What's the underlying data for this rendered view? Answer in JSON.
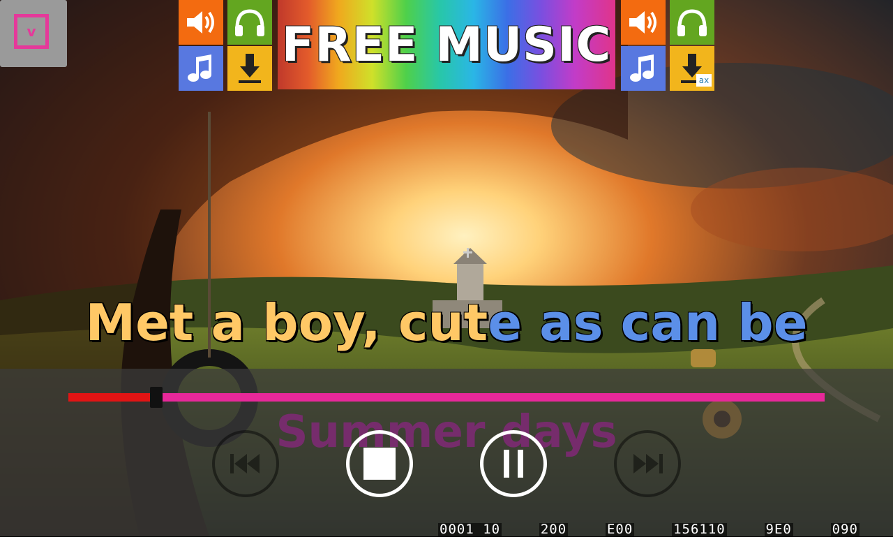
{
  "app": {
    "collapse_button": {
      "glyph": "v",
      "icon": "chevron-down-icon"
    }
  },
  "ad": {
    "title": "FREE MUSIC",
    "badge": "ax",
    "tiles": [
      {
        "icon": "speaker-icon",
        "color": "#f36b10"
      },
      {
        "icon": "headphones-icon",
        "color": "#63a620"
      },
      {
        "icon": "music-note-icon",
        "color": "#5878e0"
      },
      {
        "icon": "download-icon",
        "color": "#f2b51c"
      }
    ]
  },
  "lyrics": {
    "current_sung": "Met a boy, cut",
    "current_unsung": "e as can be",
    "next": "Summer days",
    "sung_color": "#ffc866",
    "unsung_color": "#5b8fe8"
  },
  "player": {
    "progress_fraction": 0.108,
    "played_color": "#e21414",
    "remaining_color": "#e8289a",
    "buttons": [
      {
        "name": "previous-button",
        "icon": "skip-previous-icon",
        "enabled": false
      },
      {
        "name": "stop-button",
        "icon": "stop-icon",
        "enabled": true
      },
      {
        "name": "pause-button",
        "icon": "pause-icon",
        "enabled": true
      },
      {
        "name": "next-button",
        "icon": "skip-next-icon",
        "enabled": false
      }
    ]
  },
  "status_readout": [
    "0001 10",
    "200",
    "E00",
    "156110",
    "9E0",
    "090"
  ]
}
